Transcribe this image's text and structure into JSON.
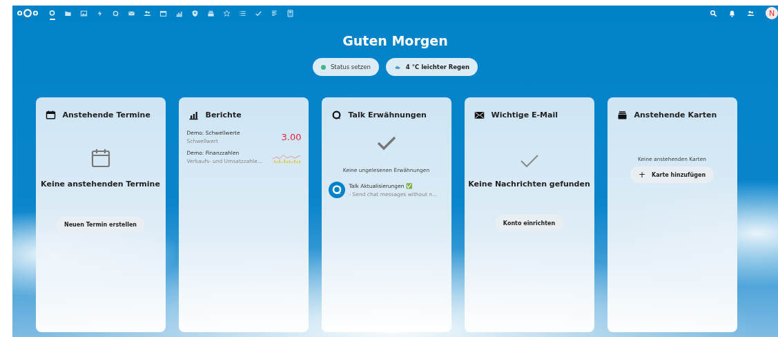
{
  "header": {
    "apps": [
      {
        "kind": "dashboard",
        "selected": true
      },
      {
        "kind": "files",
        "selected": false
      },
      {
        "kind": "photos",
        "selected": false
      },
      {
        "kind": "activity",
        "selected": false
      },
      {
        "kind": "talk",
        "selected": false
      },
      {
        "kind": "mail",
        "selected": false
      },
      {
        "kind": "contacts",
        "selected": false
      },
      {
        "kind": "calendar",
        "selected": false
      },
      {
        "kind": "analytics",
        "selected": false
      },
      {
        "kind": "passwords",
        "selected": false
      },
      {
        "kind": "deck",
        "selected": false
      },
      {
        "kind": "star",
        "selected": false
      },
      {
        "kind": "tasks",
        "selected": false
      },
      {
        "kind": "check",
        "selected": false
      },
      {
        "kind": "notes",
        "selected": false
      },
      {
        "kind": "calculator",
        "selected": false
      }
    ],
    "avatar": "N"
  },
  "greeting": "Guten Morgen",
  "status_buttons": [
    {
      "kind": "status",
      "label": "Status setzen",
      "color": "#49b382"
    },
    {
      "kind": "weather",
      "label": "4 °C leichter Regen"
    }
  ],
  "widgets": [
    {
      "kind": "calendar",
      "title": "Anstehende Termine",
      "empty_text": "Keine anstehenden Termine",
      "button": "Neuen Termin erstellen"
    },
    {
      "kind": "reports",
      "title": "Berichte",
      "items": [
        {
          "kind": "number",
          "title": "Demo: Schwellwerte",
          "subtitle": "Schwellwert",
          "value": "3.00"
        },
        {
          "kind": "sparkline",
          "title": "Demo: Finanzzahlen",
          "subtitle": "Verkaufs- und Umsatzzahle..."
        }
      ]
    },
    {
      "kind": "talk",
      "title": "Talk Erwähnungen",
      "empty_text": "Keine ungelesenen Erwähnungen",
      "items": [
        {
          "title": "Talk Aktualisierungen ✅",
          "subtitle": "- Send chat messages without n..."
        }
      ]
    },
    {
      "kind": "mail",
      "title": "Wichtige E-Mail",
      "empty_text": "Keine Nachrichten gefunden",
      "button": "Konto einrichten"
    },
    {
      "kind": "deck",
      "title": "Anstehende Karten",
      "empty_text": "Keine anstehenden Karten",
      "button": "Karte hinzufügen",
      "button_icon": "+"
    }
  ]
}
